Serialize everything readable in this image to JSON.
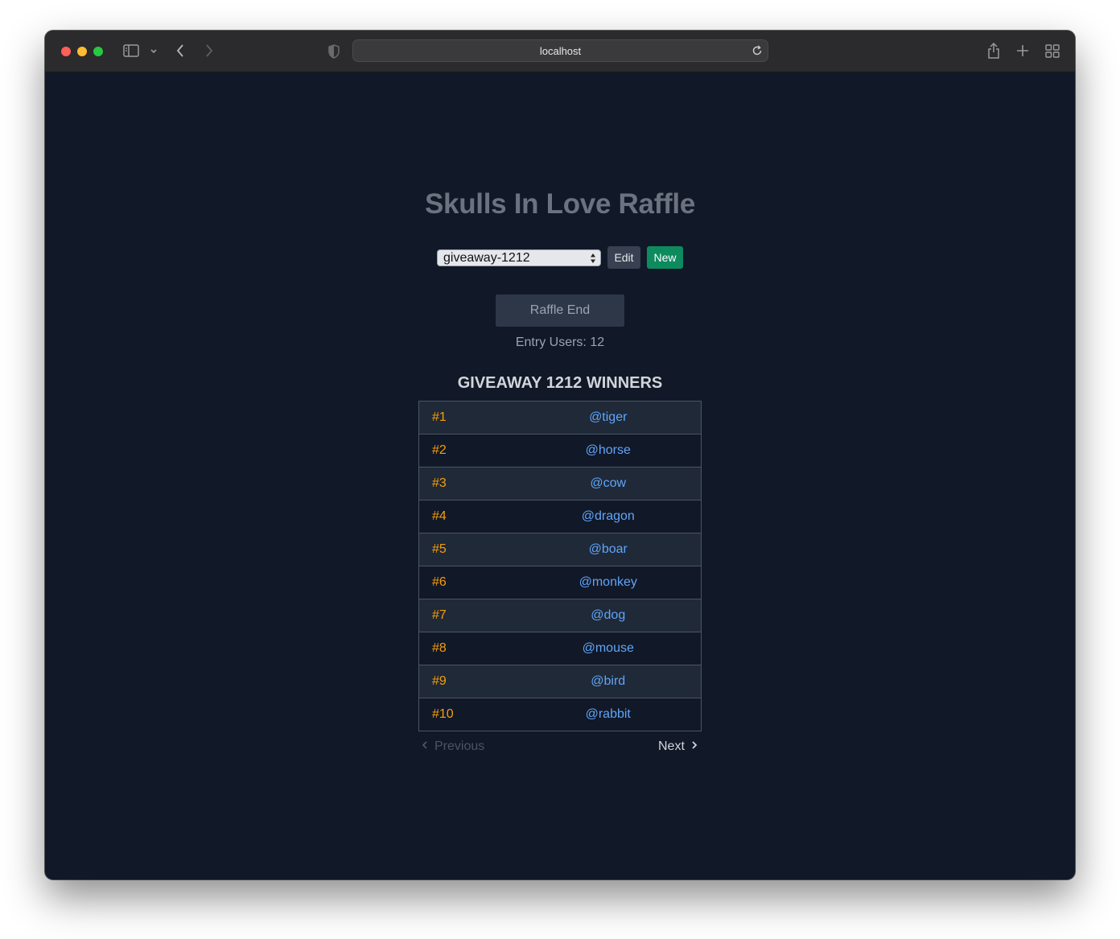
{
  "browser": {
    "url": "localhost"
  },
  "page": {
    "title": "Skulls In Love Raffle",
    "giveaway_select": {
      "selected": "giveaway-1212"
    },
    "edit_label": "Edit",
    "new_label": "New",
    "raffle_button_label": "Raffle End",
    "entry_users": "Entry Users: 12",
    "winners_title": "GIVEAWAY 1212 WINNERS",
    "winners": [
      {
        "rank": "#1",
        "user": "@tiger"
      },
      {
        "rank": "#2",
        "user": "@horse"
      },
      {
        "rank": "#3",
        "user": "@cow"
      },
      {
        "rank": "#4",
        "user": "@dragon"
      },
      {
        "rank": "#5",
        "user": "@boar"
      },
      {
        "rank": "#6",
        "user": "@monkey"
      },
      {
        "rank": "#7",
        "user": "@dog"
      },
      {
        "rank": "#8",
        "user": "@mouse"
      },
      {
        "rank": "#9",
        "user": "@bird"
      },
      {
        "rank": "#10",
        "user": "@rabbit"
      }
    ],
    "pagination": {
      "previous_label": "Previous",
      "next_label": "Next"
    }
  },
  "colors": {
    "background": "#111827",
    "rank": "#f59e0b",
    "user_link": "#60a5fa",
    "new_button": "#0e8a5f"
  },
  "icons": [
    "sidebar-icon",
    "chevron-down-icon",
    "back-icon",
    "forward-icon",
    "shield-icon",
    "reload-icon",
    "share-icon",
    "plus-icon",
    "tab-overview-icon",
    "chevron-left-icon",
    "chevron-right-icon"
  ]
}
